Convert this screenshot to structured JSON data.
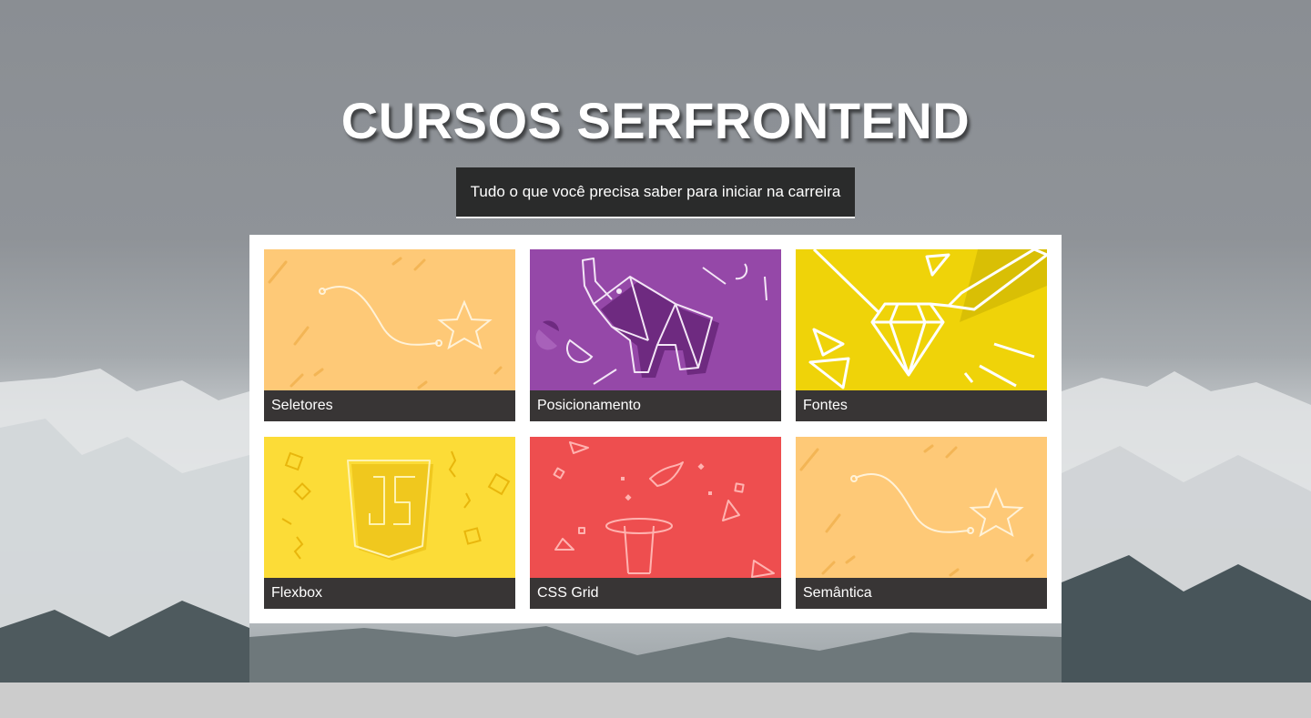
{
  "header": {
    "title": "CURSOS SERFRONTEND",
    "subtitle": "Tudo o que você precisa saber para iniciar na carreira"
  },
  "courses": [
    {
      "label": "Seletores",
      "color": "#fec977",
      "icon": "star-path-icon"
    },
    {
      "label": "Posicionamento",
      "color": "#9548a8",
      "icon": "origami-elephant-icon"
    },
    {
      "label": "Fontes",
      "color": "#efd309",
      "icon": "diamond-pencil-icon"
    },
    {
      "label": "Flexbox",
      "color": "#fcdc37",
      "icon": "js-shield-icon"
    },
    {
      "label": "CSS Grid",
      "color": "#ee4e4f",
      "icon": "magic-hat-icon"
    },
    {
      "label": "Semântica",
      "color": "#fec977",
      "icon": "star-path-icon"
    }
  ],
  "colors": {
    "caption_bg": "#383535",
    "subtitle_bg": "#2a2b2b",
    "page_bg": "#cccccc"
  }
}
